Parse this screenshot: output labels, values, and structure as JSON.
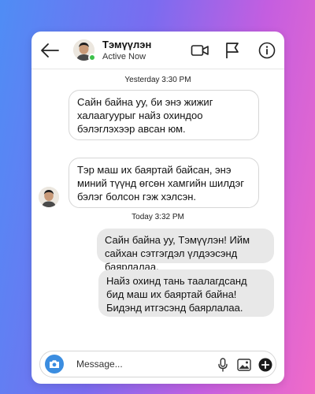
{
  "header": {
    "contact_name": "Тэмүүлэн",
    "status": "Active Now"
  },
  "timestamps": {
    "first": "Yesterday 3:30 PM",
    "second": "Today 3:32 PM"
  },
  "messages": [
    {
      "direction": "incoming",
      "text": "Сайн байна уу, би энэ жижиг халаагуурыг найз охиндоо бэлэглэхээр авсан юм."
    },
    {
      "direction": "incoming",
      "text": "Тэр маш их баяртай байсан, энэ миний түүнд өгсөн хамгийн шилдэг бэлэг болсон гэж хэлсэн."
    },
    {
      "direction": "outgoing",
      "text": "Сайн байна уу, Тэмүүлэн! Ийм сайхан сэтгэгдэл үлдээсэнд баярлалаа."
    },
    {
      "direction": "outgoing",
      "text": "Найз охинд тань таалагдсанд бид маш их баяртай байна! Бидэнд итгэсэнд баярлалаа."
    }
  ],
  "composer": {
    "placeholder": "Message..."
  },
  "colors": {
    "online": "#3cc04a",
    "camera_button": "#3b8de0",
    "outgoing_bubble": "#e8e8e8"
  },
  "icons": [
    "back-arrow-icon",
    "video-camera-icon",
    "flag-icon",
    "info-icon",
    "camera-icon",
    "microphone-icon",
    "image-icon",
    "plus-icon"
  ]
}
